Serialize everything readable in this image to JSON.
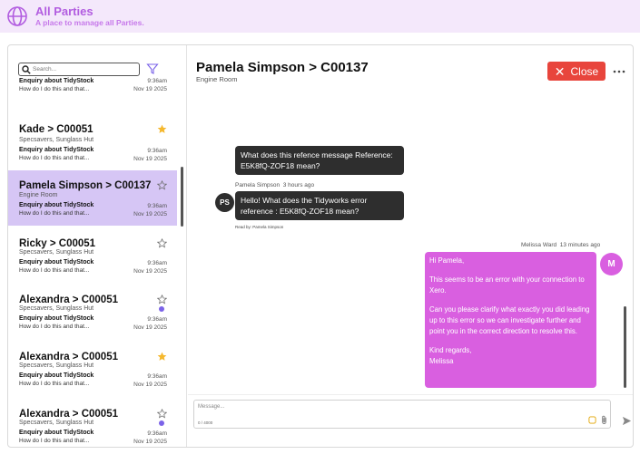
{
  "header": {
    "title": "All Parties",
    "subtitle": "A place to manage all Parties.",
    "accent": "#b25de0"
  },
  "sidebar": {
    "search_placeholder": "Search...",
    "conversations": [
      {
        "name": "",
        "subtitle": "",
        "topic": "Enquiry about TidyStock",
        "preview": "How do I do this and that...",
        "time": "9:36am",
        "date": "Nov 19 2025",
        "starred": false,
        "unread": false,
        "active": false
      },
      {
        "name": "Kade > C00051",
        "subtitle": "Specsavers, Sunglass Hut",
        "topic": "Enquiry about TidyStock",
        "preview": "How do I do this and that...",
        "time": "9:36am",
        "date": "Nov 19 2025",
        "starred": true,
        "unread": false,
        "active": false
      },
      {
        "name": "Pamela Simpson > C00137",
        "subtitle": "Engine Room",
        "topic": "Enquiry about TidyStock",
        "preview": "How do I do this and that...",
        "time": "9:36am",
        "date": "Nov 19 2025",
        "starred": false,
        "unread": false,
        "active": true
      },
      {
        "name": "Ricky > C00051",
        "subtitle": "Specsavers, Sunglass Hut",
        "topic": "Enquiry about TidyStock",
        "preview": "How do I do this and that...",
        "time": "9:36am",
        "date": "Nov 19 2025",
        "starred": false,
        "unread": false,
        "active": false
      },
      {
        "name": "Alexandra > C00051",
        "subtitle": "Specsavers, Sunglass Hut",
        "topic": "Enquiry about TidyStock",
        "preview": "How do I do this and that...",
        "time": "9:36am",
        "date": "Nov 19 2025",
        "starred": false,
        "unread": true,
        "active": false
      },
      {
        "name": "Alexandra > C00051",
        "subtitle": "Specsavers, Sunglass Hut",
        "topic": "Enquiry about TidyStock",
        "preview": "How do I do this and that...",
        "time": "9:36am",
        "date": "Nov 19 2025",
        "starred": true,
        "unread": false,
        "active": false
      },
      {
        "name": "Alexandra > C00051",
        "subtitle": "Specsavers, Sunglass Hut",
        "topic": "Enquiry about TidyStock",
        "preview": "How do I do this and that...",
        "time": "9:36am",
        "date": "Nov 19 2025",
        "starred": false,
        "unread": true,
        "active": false
      }
    ]
  },
  "chat": {
    "title": "Pamela Simpson > C00137",
    "subtitle": "Engine Room",
    "close_label": "Close",
    "messages": {
      "reference_text": "What does this refence message Reference: E5K8fQ-ZOF18 mean?",
      "incoming_author": "Pamela Simpson",
      "incoming_time": "3 hours ago",
      "incoming_avatar": "PS",
      "incoming_text": "Hello!  What does the Tidyworks error reference : E5K8fQ-ZOF18 mean?",
      "read_by": "Read by: Pamela Simpson",
      "outgoing_author": "Melissa Ward",
      "outgoing_time": "13 minutes ago",
      "outgoing_avatar": "M",
      "outgoing_paragraphs": [
        "Hi Pamela,",
        "This seems to be an error with your connection to Xero.",
        "Can you please clarify what exactly you did leading up to this error so we can investigate further and point you in the correct direction to resolve this.",
        "Kind regards,\nMelissa"
      ]
    },
    "composer": {
      "placeholder": "Message...",
      "counter": "0 / 4000"
    }
  },
  "colors": {
    "close": "#e8453c",
    "outgoing": "#d95fe0",
    "incoming": "#2e2e2e",
    "active_row": "#d6c6f5",
    "star": "#f5b82e",
    "unread_dot": "#7b63e8"
  },
  "icons": [
    "globe-icon",
    "search-icon",
    "filter-icon",
    "star-icon",
    "more-icon",
    "emoji-icon",
    "attach-icon",
    "send-icon"
  ]
}
